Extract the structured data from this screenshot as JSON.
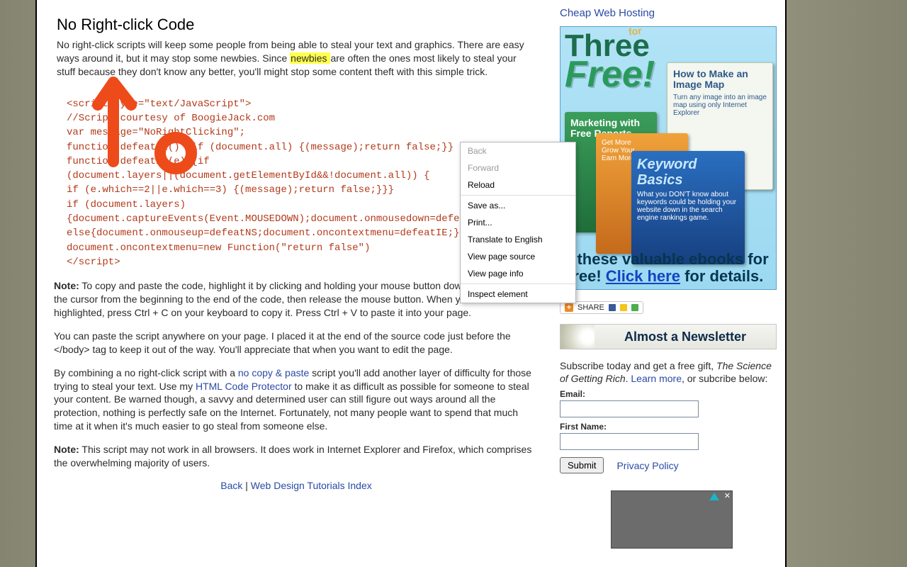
{
  "article": {
    "title": "No Right-click Code",
    "intro_before": "No right-click scripts will keep some people from being able to steal your text and graphics. There are easy ways around it, but it may stop some newbies. Since ",
    "highlight": "newbies ",
    "intro_after": "are often the ones most likely to steal your stuff because they don't know any better, you'll might stop some content theft with this simple trick.",
    "code": "<script type=\"text/JavaScript\">\n//Script courtesy of BoogieJack.com\nvar message=\"NoRightClicking\";\nfunction defeatIE() {if (document.all) {(message);return false;}}\nfunction defeatNS(e) {if\n(document.layers||(document.getElementById&&!document.all)) {\nif (e.which==2||e.which==3) {(message);return false;}}}\nif (document.layers)\n{document.captureEvents(Event.MOUSEDOWN);document.onmousedown=defeatNS;}\nelse{document.onmouseup=defeatNS;document.oncontextmenu=defeatIE;}\ndocument.oncontextmenu=new Function(\"return false\")\n</script>",
    "note1_label": "Note:",
    "note1_text": " To copy and paste the code, highlight it by clicking and holding your mouse button down and dragging the cursor from the beginning to the end of the code, then release the mouse button. When you have the code highlighted, press Ctrl + C on your keyboard to copy it. Press Ctrl + V to paste it into your page.",
    "p2": "You can paste the script anywhere on your page. I placed it at the end of the source code just before the </body> tag to keep it out of the way. You'll appreciate that when you want to edit the page.",
    "p3a": "By combining a no right-click script with a ",
    "p3_link1": "no copy & paste",
    "p3b": " script you'll add another layer of difficulty for those trying to steal your text. Use my ",
    "p3_link2": "HTML Code Protector",
    "p3c": " to make it as difficult as possible for someone to steal your content. Be warned though, a savvy and determined user can still figure out ways around all the protection, nothing is perfectly safe on the Internet. Fortunately, not many people want to spend that much time at it when it's much easier to go steal from someone else.",
    "note2_label": "Note:",
    "note2_text": " This script may not work in all browsers. It does work in Internet Explorer and Firefox, which comprises the overwhelming majority of users.",
    "back": "Back",
    "sep": " | ",
    "index": "Web Design Tutorials Index"
  },
  "sidebar": {
    "cheap": "Cheap Web Hosting",
    "tff_three": "Three",
    "tff_for": "for",
    "tff_free": "Free!",
    "book_green_title": "Marketing with Free Reports",
    "book_green_sub": "Get More\nGrow Your\nEarn More",
    "book_white_title": "How to Make an Image Map",
    "book_white_sub": "Turn any image into an image map using only Internet Explorer",
    "book_blue_title": "Keyword Basics",
    "book_blue_sub": "What you DON'T know about keywords could be holding your website down in the search engine rankings game.",
    "get_before": "t these valuable ebooks for free! ",
    "get_link": "Click here",
    "get_after": " for details.",
    "share": "SHARE",
    "newsletter_title": "Almost a Newsletter",
    "sub_before": "Subscribe today and get a free gift, ",
    "sub_italic": "The Science of Getting Rich",
    "sub_mid": ". ",
    "sub_learn": "Learn more",
    "sub_after": ", or subcribe below:",
    "email_label": "Email:",
    "fname_label": "First Name:",
    "submit": "Submit",
    "privacy": "Privacy Policy"
  },
  "ctx": {
    "back": "Back",
    "forward": "Forward",
    "reload": "Reload",
    "saveas": "Save as...",
    "print": "Print...",
    "translate": "Translate to English",
    "viewsrc": "View page source",
    "viewinfo": "View page info",
    "inspect": "Inspect element"
  }
}
